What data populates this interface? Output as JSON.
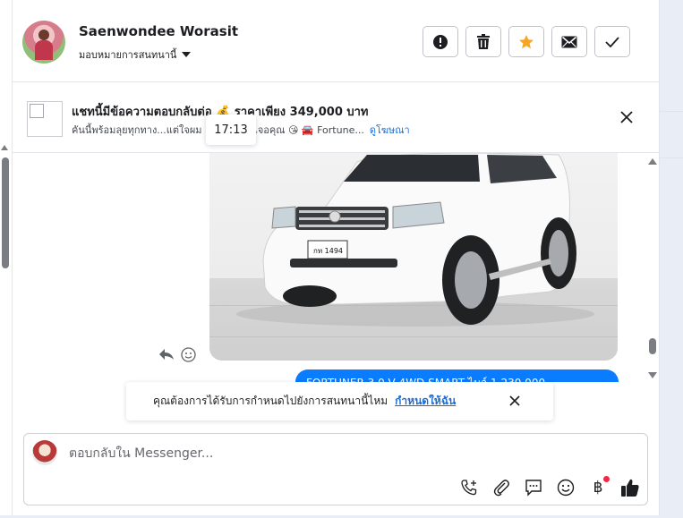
{
  "header": {
    "contact_name": "Saenwondee Worasit",
    "assign_label": "มอบหมายการสนทนานี้",
    "actions": [
      {
        "name": "report-button",
        "icon": "alert-icon"
      },
      {
        "name": "delete-button",
        "icon": "trash-icon"
      },
      {
        "name": "star-button",
        "icon": "star-icon"
      },
      {
        "name": "mark-unread-button",
        "icon": "envelope-icon"
      },
      {
        "name": "mark-done-button",
        "icon": "check-icon"
      }
    ]
  },
  "ad": {
    "title": "แชทนี้มีข้อความตอบกลับต่อ 💰 ราคาเพียง 349,000 บาท",
    "subtitle": "คันนี้พร้อมลุยทุกทาง...แต่ใจผม",
    "subtitle_tail": "กครั้งที่เจอคุณ 😘 🚘 Fortune...",
    "link": "ดูโฆษณา"
  },
  "tooltip_time": "17:13",
  "message": {
    "bubble_text": "FORTUNER 3.0 V 4WD SMART ไมล์ 1,230,000"
  },
  "followup": {
    "text": "คุณต้องการได้รับการกำหนดไปยังการสนทนานี้ไหม",
    "link": "กำหนดให้ฉัน"
  },
  "composer": {
    "placeholder": "ตอบกลับใน Messenger..."
  },
  "colors": {
    "accent": "#0a7cff",
    "star": "#f5a623",
    "link": "#1a6ed8"
  }
}
